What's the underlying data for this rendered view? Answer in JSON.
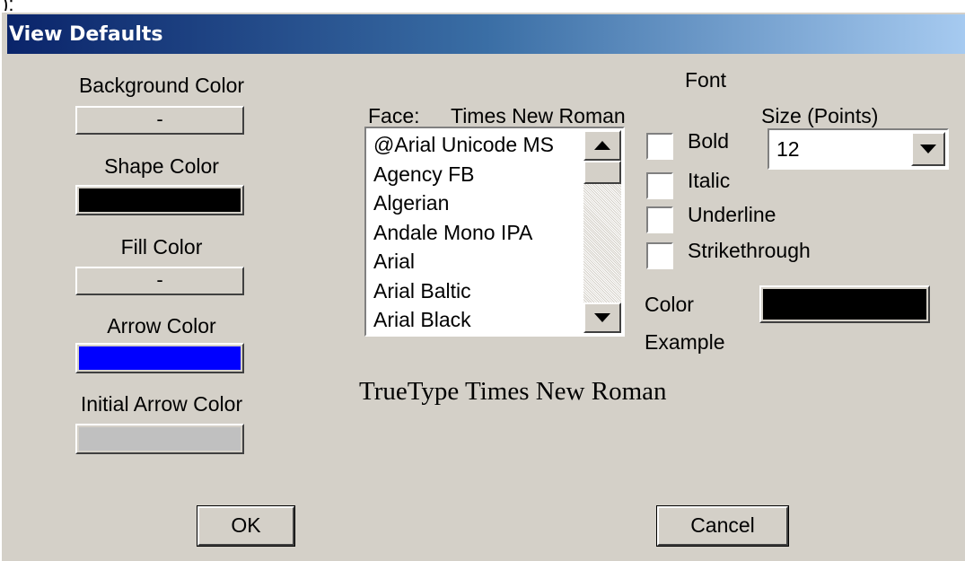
{
  "top_fragment": ");",
  "window": {
    "title": "View Defaults"
  },
  "colors_panel": {
    "background_color": {
      "label": "Background Color",
      "value": "-"
    },
    "shape_color": {
      "label": "Shape Color",
      "swatch": "#000000"
    },
    "fill_color": {
      "label": "Fill Color",
      "value": "-"
    },
    "arrow_color": {
      "label": "Arrow Color",
      "swatch": "#0000ff"
    },
    "initial_arrow_color": {
      "label": "Initial Arrow Color",
      "swatch": "#c0c0c0"
    }
  },
  "font": {
    "heading": "Font",
    "face_label": "Face:",
    "face_value": "Times New Roman",
    "face_list": [
      "@Arial Unicode MS",
      "Agency FB",
      "Algerian",
      "Andale Mono IPA",
      "Arial",
      "Arial Baltic",
      "Arial Black"
    ],
    "size_label": "Size (Points)",
    "size_value": "12",
    "styles": {
      "bold": "Bold",
      "italic": "Italic",
      "underline": "Underline",
      "strikethrough": "Strikethrough"
    },
    "color_label": "Color",
    "color_swatch": "#000000",
    "example_label": "Example",
    "example_text": "TrueType Times New Roman"
  },
  "buttons": {
    "ok": "OK",
    "cancel": "Cancel"
  }
}
